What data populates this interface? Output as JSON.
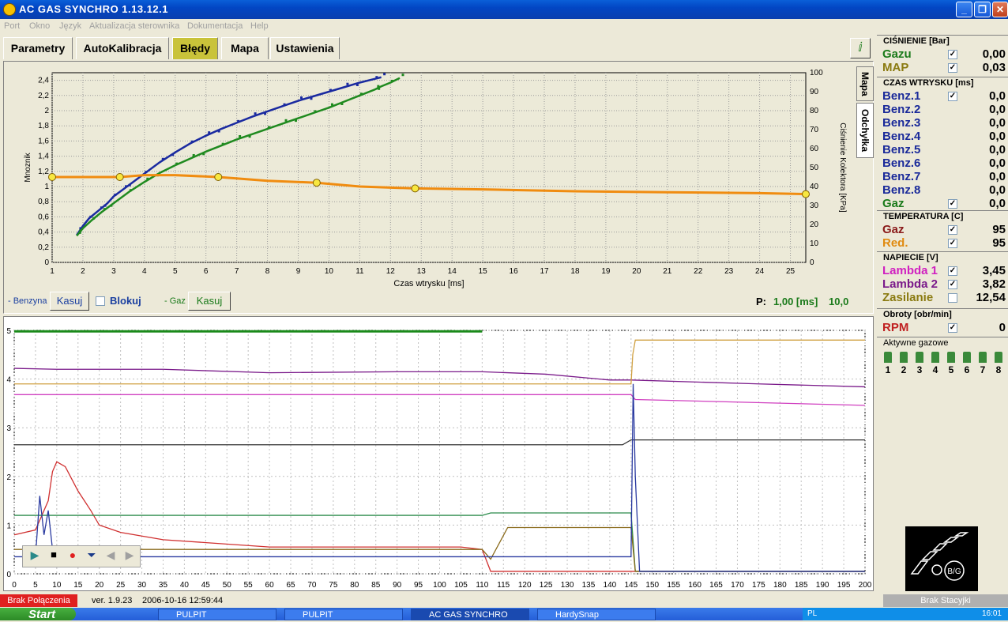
{
  "window": {
    "title": "AC GAS SYNCHRO     1.13.12.1"
  },
  "menu": [
    "Port",
    "Okno",
    "Język",
    "Aktualizacja sterownika",
    "Dokumentacja",
    "Help"
  ],
  "tabs": [
    "Parametry",
    "AutoKalibracja",
    "Błędy",
    "Mapa",
    "Ustawienia"
  ],
  "active_tab": "Błędy",
  "side_tabs": [
    "Mapa",
    "Odchyłka"
  ],
  "map_chart": {
    "ylabel": "Mnoznik",
    "y2label": "Ciśnienie Kolektora [KPa]",
    "xlabel": "Czas wtrysku [ms]",
    "x_ticks": [
      "1",
      "2",
      "3",
      "4",
      "5",
      "6",
      "7",
      "8",
      "9",
      "10",
      "11",
      "12",
      "13",
      "14",
      "15",
      "16",
      "17",
      "18",
      "19",
      "20",
      "21",
      "22",
      "23",
      "24",
      "25"
    ],
    "y_ticks": [
      "0",
      "0,2",
      "0,4",
      "0,6",
      "0,8",
      "1",
      "1,2",
      "1,4",
      "1,6",
      "1,8",
      "2",
      "2,2",
      "2,4"
    ],
    "y2_ticks": [
      "0",
      "10",
      "20",
      "30",
      "40",
      "50",
      "60",
      "70",
      "80",
      "90",
      "100"
    ]
  },
  "controls": {
    "benzyna_label": "- Benzyna",
    "kasuj": "Kasuj",
    "blokuj": "Blokuj",
    "gaz_label": "- Gaz",
    "p_label": "P:",
    "p_value": "1,00 [ms]",
    "p_value2": "10,0"
  },
  "chart_data": [
    {
      "type": "scatter",
      "xlabel": "Czas wtrysku [ms]",
      "ylabel": "Mnoznik",
      "y2label": "Ciśnienie Kolektora [KPa]",
      "xlim": [
        1,
        25.5
      ],
      "ylim": [
        0,
        2.5
      ],
      "y2lim": [
        0,
        100
      ],
      "series": [
        {
          "name": "Benzyna",
          "color": "#1a2aa0",
          "x": [
            1.8,
            2.0,
            2.2,
            2.5,
            2.8,
            3.0,
            3.3,
            3.6,
            4.0,
            4.5,
            5.0,
            5.5,
            6.0,
            6.5,
            7.0,
            7.5,
            8.0,
            8.5,
            9.0,
            9.5,
            10.0,
            10.5,
            11.0,
            11.5,
            11.7
          ],
          "y": [
            0.36,
            0.48,
            0.58,
            0.68,
            0.78,
            0.87,
            0.96,
            1.05,
            1.17,
            1.32,
            1.45,
            1.57,
            1.67,
            1.76,
            1.84,
            1.92,
            1.99,
            2.06,
            2.13,
            2.19,
            2.25,
            2.31,
            2.37,
            2.42,
            2.44
          ]
        },
        {
          "name": "Gaz",
          "color": "#1f8a1f",
          "x": [
            1.8,
            2.0,
            2.3,
            2.6,
            3.0,
            3.5,
            4.0,
            4.5,
            5.0,
            5.5,
            6.0,
            6.5,
            7.0,
            7.5,
            8.0,
            8.5,
            9.0,
            9.5,
            10.0,
            10.5,
            11.0,
            11.5,
            11.7,
            12.0,
            12.3
          ],
          "y": [
            0.35,
            0.45,
            0.56,
            0.66,
            0.78,
            0.93,
            1.06,
            1.18,
            1.28,
            1.37,
            1.46,
            1.54,
            1.62,
            1.69,
            1.76,
            1.83,
            1.9,
            1.97,
            2.04,
            2.12,
            2.2,
            2.28,
            2.32,
            2.37,
            2.43
          ]
        },
        {
          "name": "Ciśnienie",
          "color": "#f08c10",
          "x": [
            1,
            3.2,
            4,
            5,
            6.4,
            8,
            9.6,
            11,
            12.8,
            15,
            18,
            21,
            24,
            25.5
          ],
          "y2": [
            45,
            45,
            46,
            46,
            45,
            43,
            42,
            40,
            39,
            38.5,
            37.5,
            37,
            36.5,
            36
          ]
        }
      ]
    },
    {
      "type": "line",
      "xlim": [
        0,
        200
      ],
      "ylim": [
        0,
        5
      ],
      "x_ticks": [
        "0",
        "5",
        "10",
        "15",
        "20",
        "25",
        "30",
        "35",
        "40",
        "45",
        "50",
        "55",
        "60",
        "65",
        "70",
        "75",
        "80",
        "85",
        "90",
        "95",
        "100",
        "105",
        "110",
        "115",
        "120",
        "125",
        "130",
        "135",
        "140",
        "145",
        "150",
        "155",
        "160",
        "165",
        "170",
        "175",
        "180",
        "185",
        "190",
        "195",
        "200"
      ],
      "y_ticks": [
        "0",
        "1",
        "2",
        "3",
        "4",
        "5"
      ],
      "series": [
        {
          "color": "#1a8a1a",
          "x": [
            0,
            110
          ],
          "y": [
            4.98,
            4.98
          ]
        },
        {
          "color": "#7a1a8a",
          "x": [
            0,
            10,
            35,
            60,
            90,
            110,
            125,
            140,
            145,
            175,
            200
          ],
          "y": [
            4.22,
            4.2,
            4.2,
            4.13,
            4.15,
            4.15,
            4.1,
            3.98,
            3.98,
            3.9,
            3.84
          ]
        },
        {
          "color": "#d0a040",
          "x": [
            0,
            5,
            10,
            35,
            60,
            90,
            110,
            145,
            145.4,
            146,
            200
          ],
          "y": [
            3.9,
            3.9,
            3.9,
            3.9,
            3.9,
            3.9,
            3.9,
            3.9,
            4.5,
            4.8,
            4.8
          ]
        },
        {
          "color": "#d040c0",
          "x": [
            0,
            110,
            145,
            146,
            200
          ],
          "y": [
            3.68,
            3.68,
            3.68,
            3.58,
            3.46
          ]
        },
        {
          "color": "#303030",
          "x": [
            0,
            143,
            145,
            200
          ],
          "y": [
            2.65,
            2.65,
            2.75,
            2.75
          ]
        },
        {
          "color": "#d03030",
          "x": [
            0,
            5,
            8,
            9,
            10,
            12,
            15,
            18,
            20,
            25,
            35,
            60,
            90,
            105,
            110,
            112,
            145,
            200
          ],
          "y": [
            0.8,
            0.9,
            1.5,
            2.1,
            2.3,
            2.2,
            1.7,
            1.3,
            1.0,
            0.85,
            0.7,
            0.55,
            0.55,
            0.55,
            0.5,
            0.05,
            0.05,
            0.05
          ]
        },
        {
          "color": "#2a8a4a",
          "x": [
            0,
            10,
            25,
            60,
            110,
            112,
            140,
            145,
            146,
            200
          ],
          "y": [
            1.2,
            1.2,
            1.2,
            1.2,
            1.2,
            1.25,
            1.25,
            1.25,
            0.05,
            0.05
          ]
        },
        {
          "color": "#8a6a1a",
          "x": [
            0,
            110,
            112,
            116,
            145,
            146,
            200
          ],
          "y": [
            0.5,
            0.5,
            0.3,
            0.95,
            0.95,
            0.05,
            0.05
          ]
        },
        {
          "color": "#2a3aa0",
          "x": [
            0,
            5,
            6,
            7,
            8,
            9,
            10,
            110,
            144,
            145,
            145.5,
            146,
            147,
            200
          ],
          "y": [
            0.35,
            0.35,
            1.6,
            0.8,
            1.3,
            0.5,
            0.35,
            0.35,
            0.35,
            0.35,
            3.9,
            2.0,
            0.05,
            0.05
          ]
        }
      ]
    }
  ],
  "playback": {
    "play": "play-icon",
    "stop": "stop-icon",
    "record": "record-icon",
    "down": "down-icon",
    "back": "back-icon",
    "fwd": "forward-icon"
  },
  "right_panel": {
    "cisnienie": {
      "title": "CIŚNIENIE [Bar]",
      "rows": [
        {
          "label": "Gazu",
          "value": "0,00",
          "color": "#1a7a1a",
          "checked": true
        },
        {
          "label": "MAP",
          "value": "0,03",
          "color": "#8a7a10",
          "checked": true
        }
      ]
    },
    "czas": {
      "title": "CZAS WTRYSKU  [ms]",
      "rows": [
        {
          "label": "Benz.1",
          "value": "0,0",
          "color": "#1a2a9a",
          "checked": true
        },
        {
          "label": "Benz.2",
          "value": "0,0",
          "color": "#1a2a9a",
          "checked": null
        },
        {
          "label": "Benz.3",
          "value": "0,0",
          "color": "#1a2a9a",
          "checked": null
        },
        {
          "label": "Benz.4",
          "value": "0,0",
          "color": "#1a2a9a",
          "checked": null
        },
        {
          "label": "Benz.5",
          "value": "0,0",
          "color": "#1a2a9a",
          "checked": null
        },
        {
          "label": "Benz.6",
          "value": "0,0",
          "color": "#1a2a9a",
          "checked": null
        },
        {
          "label": "Benz.7",
          "value": "0,0",
          "color": "#1a2a9a",
          "checked": null
        },
        {
          "label": "Benz.8",
          "value": "0,0",
          "color": "#1a2a9a",
          "checked": null
        },
        {
          "label": "Gaz",
          "value": "0,0",
          "color": "#1a7a1a",
          "checked": true
        }
      ]
    },
    "temperatura": {
      "title": "TEMPERATURA  [C]",
      "rows": [
        {
          "label": "Gaz",
          "value": "95",
          "color": "#8a1a1a",
          "checked": true
        },
        {
          "label": "Red.",
          "value": "95",
          "color": "#e08a10",
          "checked": true
        }
      ]
    },
    "napiecie": {
      "title": "NAPIECIE [V]",
      "rows": [
        {
          "label": "Lambda 1",
          "value": "3,45",
          "color": "#d020c0",
          "checked": true
        },
        {
          "label": "Lambda 2",
          "value": "3,82",
          "color": "#7a1a8a",
          "checked": true
        },
        {
          "label": "Zasilanie",
          "value": "12,54",
          "color": "#8a7a10",
          "checked": false
        }
      ]
    },
    "obroty": {
      "title": "Obroty [obr/min]",
      "rows": [
        {
          "label": "RPM",
          "value": "0",
          "color": "#c02020",
          "checked": true
        }
      ]
    },
    "aktywne": {
      "title": "Aktywne gazowe",
      "nums": [
        "1",
        "2",
        "3",
        "4",
        "5",
        "6",
        "7",
        "8"
      ]
    },
    "logo_text": "B/G"
  },
  "status": {
    "left": "Brak Połączenia",
    "version": "ver. 1.9.23",
    "datetime": "2006-10-16  12:59:44",
    "right": "Brak Stacyjki"
  },
  "taskbar": {
    "start": "Start",
    "items": [
      "PULPIT",
      "PULPIT",
      "AC GAS SYNCHRO",
      "HardySnap"
    ],
    "clock": "16:01",
    "lang": "PL"
  }
}
